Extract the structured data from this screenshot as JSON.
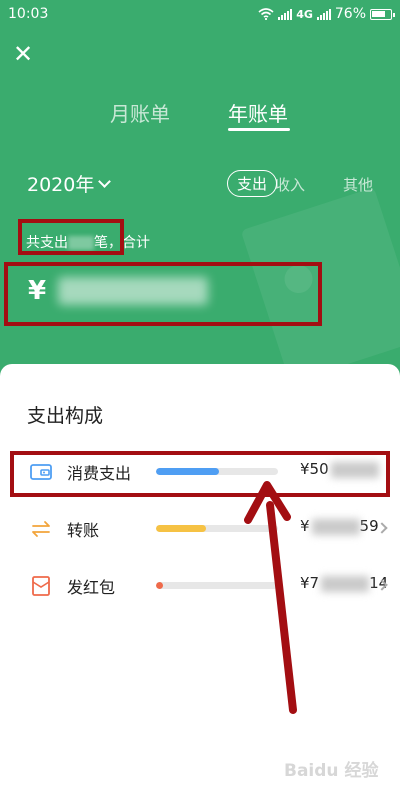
{
  "status_bar": {
    "time": "10:03",
    "network": "4G",
    "battery": "76%",
    "battery_level": 0.76,
    "wifi_icon": "wifi-icon",
    "signal_icon": "signal-icon"
  },
  "header": {
    "close_icon": "close-icon",
    "tabs": [
      {
        "label": "月账单",
        "active": false
      },
      {
        "label": "年账单",
        "active": true
      }
    ],
    "year": "2020年",
    "filters": [
      {
        "label": "支出",
        "active": true
      },
      {
        "label": "收入",
        "active": false
      },
      {
        "label": "其他",
        "active": false
      }
    ]
  },
  "summary": {
    "prefix": "共支出",
    "suffix": "笔，合计",
    "currency": "¥"
  },
  "breakdown": {
    "title": "支出构成",
    "items": [
      {
        "label": "消费支出",
        "icon": "wallet-icon",
        "amount_prefix": "¥50",
        "amount_suffix": "",
        "bar_color": "#4f9ef3",
        "share": 0.52
      },
      {
        "label": "转账",
        "icon": "transfer-icon",
        "amount_prefix": "¥",
        "amount_suffix": "59",
        "bar_color": "#f6c244",
        "share": 0.41
      },
      {
        "label": "发红包",
        "icon": "red-envelope-icon",
        "amount_prefix": "¥7",
        "amount_suffix": "14",
        "bar_color": "#ef6a4a",
        "share": 0.06
      }
    ]
  },
  "colors": {
    "header_bg": "#3aac6e",
    "annotation": "#a30e12"
  },
  "watermark": "Baidu 经验"
}
